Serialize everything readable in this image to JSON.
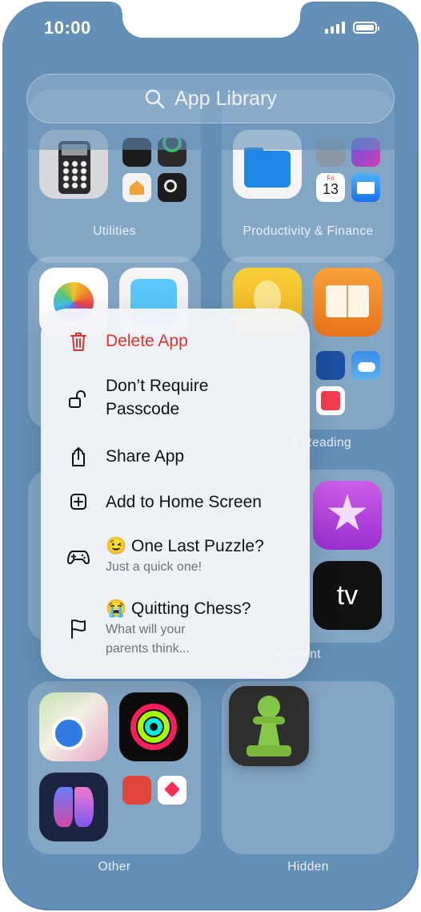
{
  "status_bar": {
    "time": "10:00"
  },
  "search": {
    "placeholder": "App Library"
  },
  "folders": {
    "utilities": "Utilities",
    "productivity": "Productivity & Finance",
    "reading": "& Reading",
    "entertainment": "ainment",
    "other": "Other",
    "hidden": "Hidden"
  },
  "calendar_mini": {
    "day": "Fri",
    "date": "13"
  },
  "context_menu": {
    "delete": "Delete App",
    "passcode_line1": "Don’t Require",
    "passcode_line2": "Passcode",
    "share": "Share App",
    "add_home": "Add to Home Screen",
    "puzzle_emoji": "😉",
    "puzzle_title": "One Last Puzzle?",
    "puzzle_sub": "Just a quick one!",
    "chess_emoji": "😭",
    "chess_title": "Quitting Chess?",
    "chess_sub_line1": "What will your",
    "chess_sub_line2": "parents think..."
  },
  "colors": {
    "background": "#6490b7",
    "destructive": "#e0312d",
    "chess_green": "#7fbf3f"
  }
}
